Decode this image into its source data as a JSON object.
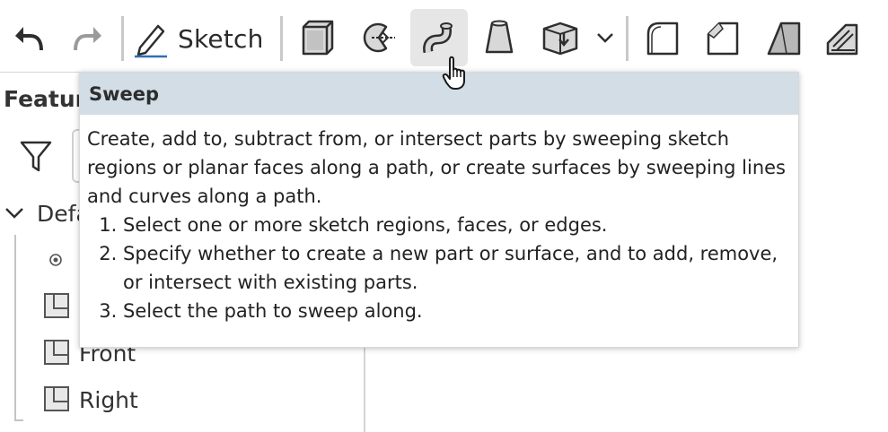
{
  "toolbar": {
    "sketch_label": "Sketch",
    "tools": [
      {
        "name": "undo",
        "icon": "undo-arrow-icon"
      },
      {
        "name": "redo",
        "icon": "redo-arrow-icon"
      },
      {
        "name": "sketch",
        "icon": "pencil-icon"
      },
      {
        "name": "extrude",
        "icon": "extrude-cube-icon"
      },
      {
        "name": "revolve",
        "icon": "revolve-icon"
      },
      {
        "name": "sweep",
        "icon": "sweep-icon",
        "hovered": true
      },
      {
        "name": "loft",
        "icon": "loft-icon"
      },
      {
        "name": "thicken",
        "icon": "thicken-icon"
      },
      {
        "name": "more",
        "icon": "chevron-down-icon"
      },
      {
        "name": "fillet",
        "icon": "fillet-icon"
      },
      {
        "name": "chamfer",
        "icon": "chamfer-icon"
      },
      {
        "name": "draft",
        "icon": "draft-icon"
      },
      {
        "name": "rib",
        "icon": "rib-icon"
      }
    ]
  },
  "panel": {
    "title": "Feature",
    "tree_root": "Defa",
    "planes": [
      "Front",
      "Right"
    ]
  },
  "tooltip": {
    "title": "Sweep",
    "description": "Create, add to, subtract from, or intersect parts by sweeping sketch regions or planar faces along a path, or create surfaces by sweeping lines and curves along a path.",
    "steps": [
      "Select one or more sketch regions, faces, or edges.",
      "Specify whether to create a new part or surface, and to add, remove, or intersect with existing parts.",
      "Select the path to sweep along."
    ]
  },
  "colors": {
    "tooltip_header_bg": "#d2dde5",
    "hover_bg": "#e6e6e6",
    "icon_stroke": "#2e2e2e",
    "icon_fill": "#d8d8d8"
  }
}
